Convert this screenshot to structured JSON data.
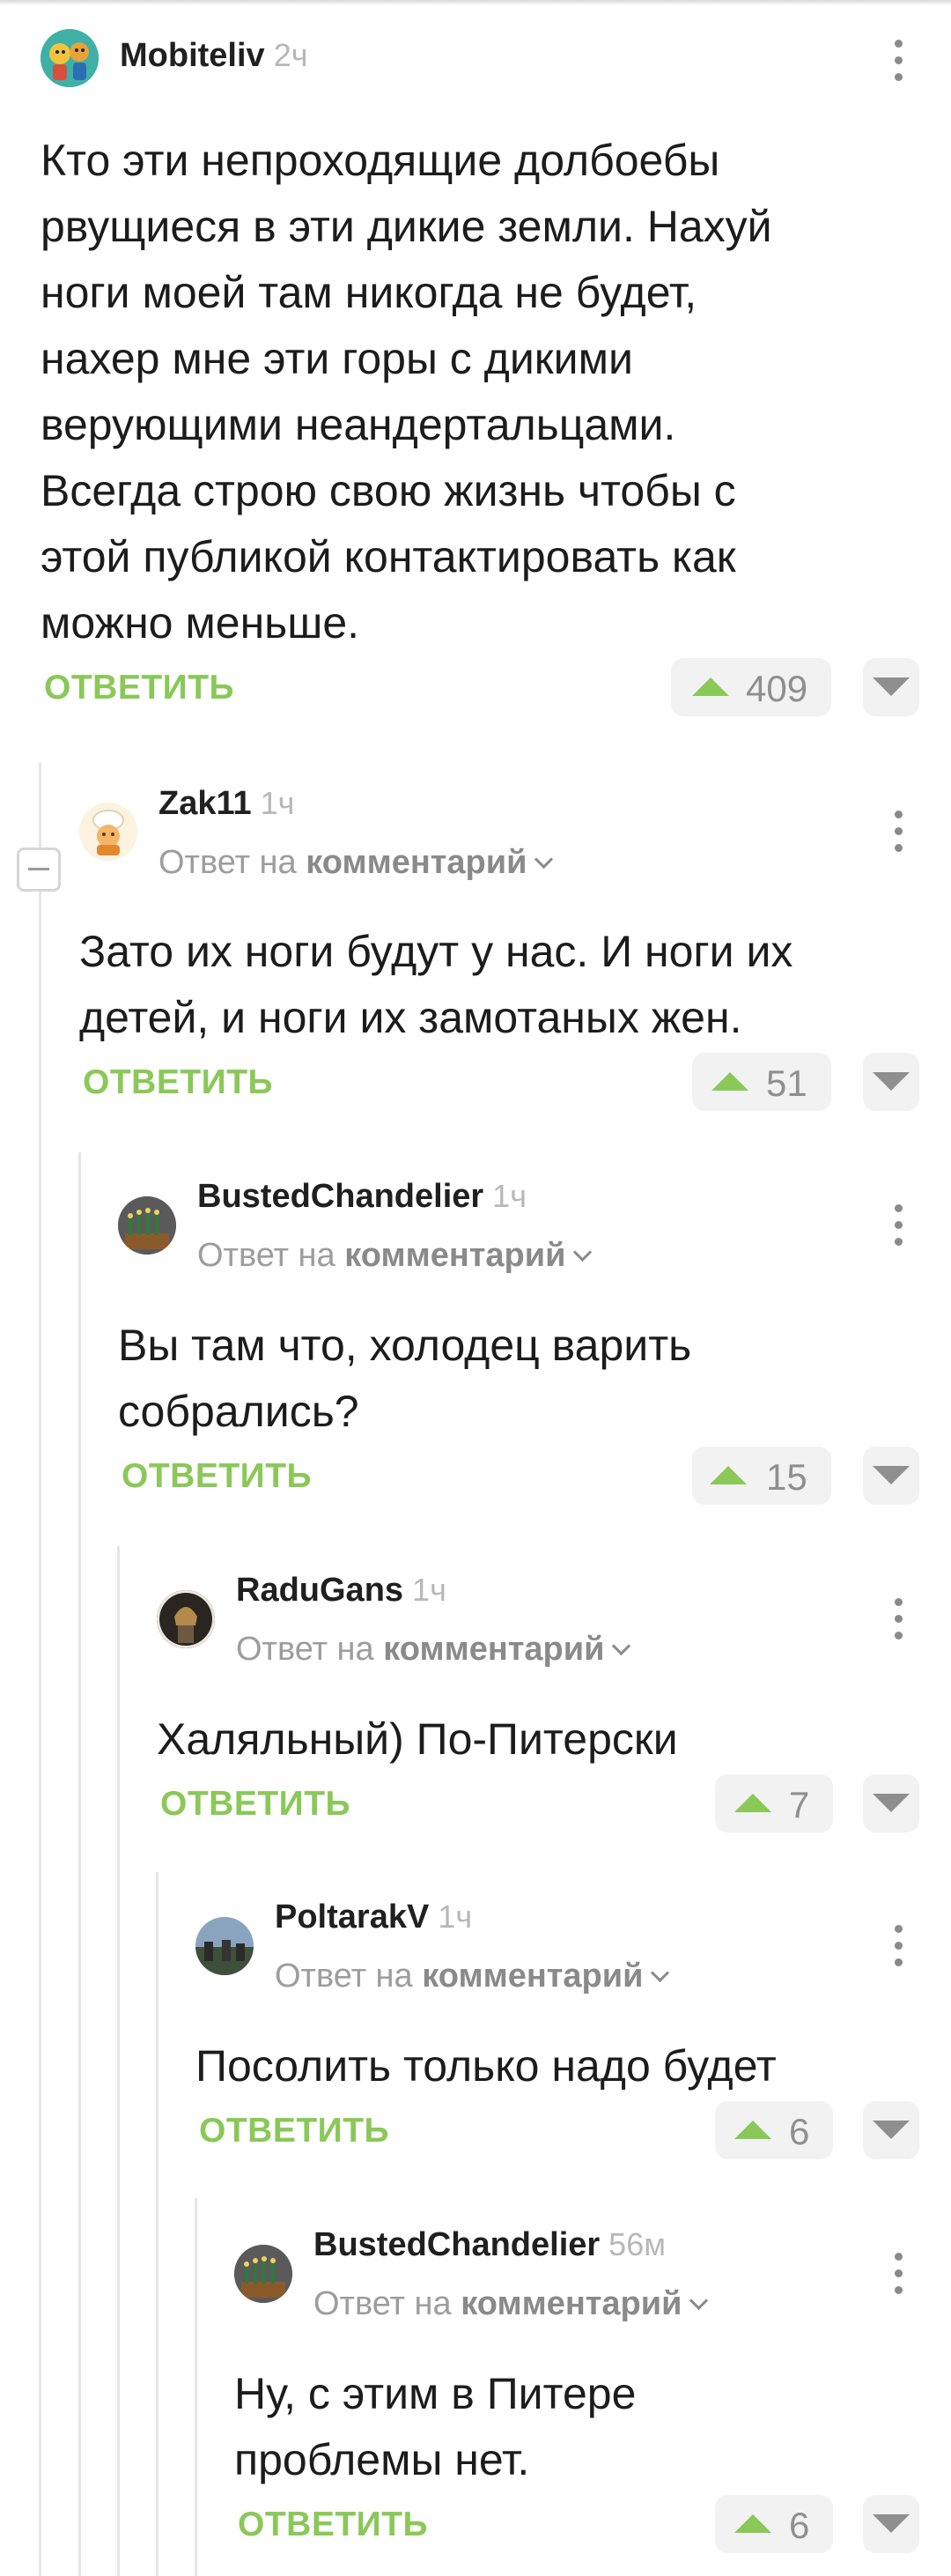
{
  "labels": {
    "reply_prefix": "Ответ на",
    "reply_target": "комментарий",
    "reply_button": "ОТВЕТИТЬ"
  },
  "colors": {
    "accent_green": "#8ac858",
    "muted": "#8f8f8f",
    "text": "#1c1c1c"
  },
  "comments": [
    {
      "author": "Mobiteliv",
      "time": "2ч",
      "body": "Кто эти непроходящие долбоебы\nрвущиеся в эти дикие земли. Нахуй\nноги моей там никогда не будет,\nнахер мне эти горы с дикими\nверующими неандертальцами.\nВсегда строю свою жизнь чтобы с\nэтой публикой контактировать как\nможно меньше.",
      "rating": "409",
      "avatar_icon": "cartoon-duo-avatar"
    },
    {
      "author": "Zak11",
      "time": "1ч",
      "body": "Зато их ноги будут у нас. И ноги их\nдетей, и ноги их замотаных жен.",
      "rating": "51",
      "avatar_icon": "chef-avatar"
    },
    {
      "author": "BustedChandelier",
      "time": "1ч",
      "body": "Вы там что, холодец варить\nсобрались?",
      "rating": "15",
      "avatar_icon": "chandelier-avatar"
    },
    {
      "author": "RaduGans",
      "time": "1ч",
      "body": "Халяльный) По-Питерски",
      "rating": "7",
      "avatar_icon": "warrior-avatar"
    },
    {
      "author": "PoltarakV",
      "time": "1ч",
      "body": "Посолить только надо будет",
      "rating": "6",
      "avatar_icon": "landscape-avatar"
    },
    {
      "author": "BustedChandelier",
      "time": "56м",
      "body": "Ну, с этим в Питере\nпроблемы нет.",
      "rating": "6",
      "avatar_icon": "chandelier-avatar"
    }
  ]
}
